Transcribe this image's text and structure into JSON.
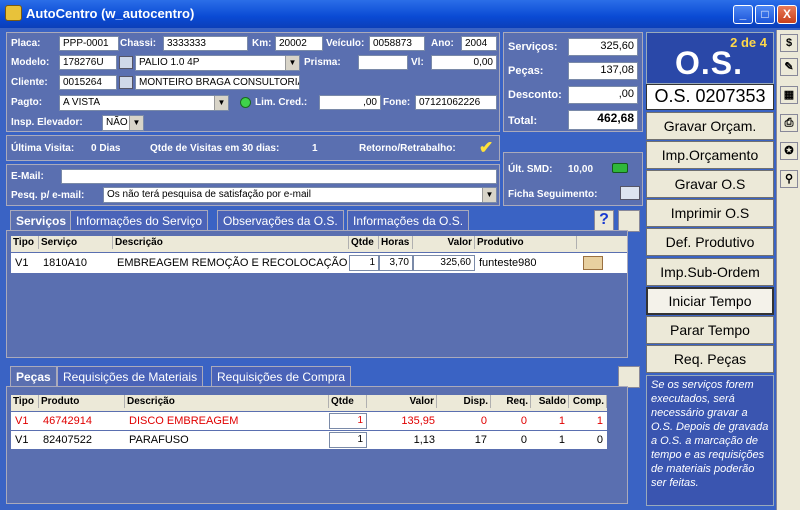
{
  "window": {
    "title": "AutoCentro (w_autocentro)",
    "min": "_",
    "max": "□",
    "close": "X"
  },
  "vehicle": {
    "placa_label": "Placa:",
    "placa": "PPP-0001",
    "chassi_label": "Chassi:",
    "chassi": "3333333",
    "km_label": "Km:",
    "km": "20002",
    "veiculo_label": "Veículo:",
    "veiculo": "0058873",
    "ano_label": "Ano:",
    "ano": "2004",
    "modelo_label": "Modelo:",
    "modelo_code": "178276U",
    "modelo": "PALIO 1.0 4P",
    "prisma_label": "Prisma:",
    "prisma": "",
    "vl_label": "Vl:",
    "vl": "0,00",
    "cliente_label": "Cliente:",
    "cliente_code": "0015264",
    "cliente": "MONTEIRO BRAGA CONSULTORIA",
    "pagto_label": "Pagto:",
    "pagto": "A VISTA",
    "limcred_label": "Lim. Cred.:",
    "limcred": ",00",
    "fone_label": "Fone:",
    "fone": "07121062226",
    "insp_label": "Insp. Elevador:",
    "insp": "NÃO"
  },
  "totals": {
    "servicos_label": "Serviços:",
    "servicos": "325,60",
    "pecas_label": "Peças:",
    "pecas": "137,08",
    "desconto_label": "Desconto:",
    "desconto": ",00",
    "total_label": "Total:",
    "total": "462,68"
  },
  "visit": {
    "ultima_label": "Última Visita:",
    "ultima": "0 Dias",
    "qtde_label": "Qtde de Visitas em 30 dias:",
    "qtde": "1",
    "retorno_label": "Retorno/Retrabalho:"
  },
  "contact": {
    "email_label": "E-Mail:",
    "email": "",
    "pesq_label": "Pesq. p/ e-mail:",
    "pesq": "Os não terá pesquisa de satisfação por e-mail"
  },
  "smd": {
    "ult_label": "Últ. SMD:",
    "ult": "10,00",
    "ficha_label": "Ficha Seguimento:"
  },
  "os": {
    "page": "2 de 4",
    "title": "O.S.",
    "number": "O.S. 0207353"
  },
  "actions": [
    {
      "label": "Gravar Orçam."
    },
    {
      "label": "Imp.Orçamento"
    },
    {
      "label": "Gravar O.S"
    },
    {
      "label": "Imprimir O.S"
    },
    {
      "label": "Def. Produtivo"
    },
    {
      "label": "Imp.Sub-Ordem"
    },
    {
      "label": "Iniciar Tempo"
    },
    {
      "label": "Parar Tempo"
    },
    {
      "label": "Req. Peças"
    }
  ],
  "note": "Se os serviços forem executados, será necessário gravar a O.S. Depois de gravada a O.S. a marcação de tempo e as requisições de materiais poderão ser feitas.",
  "services_tabs": [
    "Serviços",
    "Informações do Serviço",
    "Observações da O.S.",
    "Informações da O.S."
  ],
  "services_help": "?",
  "services_cols": [
    "Tipo",
    "Serviço",
    "Descrição",
    "Qtde",
    "Horas",
    "Valor",
    "Produtivo"
  ],
  "services_rows": [
    {
      "tipo": "V1",
      "servico": "1810A10",
      "descricao": "EMBREAGEM REMOÇÃO E RECOLOCAÇÃO",
      "qtde": "1",
      "horas": "3,70",
      "valor": "325,60",
      "produtivo": "funteste980"
    }
  ],
  "parts_tabs": [
    "Peças",
    "Requisições de Materiais",
    "Requisições de Compra"
  ],
  "parts_cols": [
    "Tipo",
    "Produto",
    "Descrição",
    "Qtde",
    "Valor",
    "Disp.",
    "Req.",
    "Saldo",
    "Comp."
  ],
  "parts_rows": [
    {
      "tipo": "V1",
      "produto": "46742914",
      "descricao": "DISCO EMBREAGEM",
      "qtde": "1",
      "valor": "135,95",
      "disp": "0",
      "req": "0",
      "saldo": "1",
      "comp": "1"
    },
    {
      "tipo": "V1",
      "produto": "82407522",
      "descricao": "PARAFUSO",
      "qtde": "1",
      "valor": "1,13",
      "disp": "17",
      "req": "0",
      "saldo": "1",
      "comp": "0"
    }
  ],
  "sidebar_icons": [
    "$",
    "✎",
    "▦",
    "⎙",
    "✪",
    "⚲"
  ],
  "colors": {
    "red_row": "#e00000",
    "os_yellow": "#ffd84a"
  }
}
